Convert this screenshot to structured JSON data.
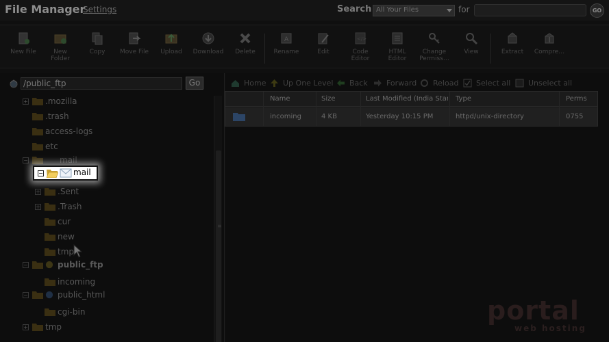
{
  "app": {
    "title": "File Manager",
    "settings_link": "Settings",
    "search_label": "Search",
    "search_scope": "All Your Files",
    "for_label": "for",
    "search_value": "",
    "go_label": "GO"
  },
  "toolbar": [
    {
      "label": "New File",
      "icon": "new-file-icon"
    },
    {
      "label": "New\nFolder",
      "icon": "new-folder-icon"
    },
    {
      "label": "Copy",
      "icon": "copy-icon"
    },
    {
      "label": "Move File",
      "icon": "move-file-icon"
    },
    {
      "label": "Upload",
      "icon": "upload-icon"
    },
    {
      "label": "Download",
      "icon": "download-icon"
    },
    {
      "label": "Delete",
      "icon": "delete-icon"
    },
    {
      "label": "Rename",
      "icon": "rename-icon"
    },
    {
      "label": "Edit",
      "icon": "edit-icon"
    },
    {
      "label": "Code\nEditor",
      "icon": "code-editor-icon"
    },
    {
      "label": "HTML\nEditor",
      "icon": "html-editor-icon"
    },
    {
      "label": "Change\nPermiss…",
      "icon": "change-permissions-icon"
    },
    {
      "label": "View",
      "icon": "view-icon"
    },
    {
      "label": "Extract",
      "icon": "extract-icon"
    },
    {
      "label": "Compre…",
      "icon": "compress-icon"
    }
  ],
  "path_bar": {
    "value": "/public_ftp",
    "go_label": "Go"
  },
  "tree": [
    {
      "label": ".mozilla",
      "expander": "+"
    },
    {
      "label": ".trash"
    },
    {
      "label": "access-logs"
    },
    {
      "label": "etc"
    },
    {
      "label": "mail",
      "expander": "-"
    },
    {
      "label": "mail",
      "expander": "-",
      "selected": true
    },
    {
      "label": ".Sent",
      "expander": "+"
    },
    {
      "label": ".Trash",
      "expander": "+"
    },
    {
      "label": "cur"
    },
    {
      "label": "new"
    },
    {
      "label": "tmp"
    },
    {
      "label": "public_ftp",
      "expander": "-",
      "bold": true
    },
    {
      "label": "incoming"
    },
    {
      "label": "public_html",
      "expander": "-"
    },
    {
      "label": "cgi-bin"
    },
    {
      "label": "tmp",
      "expander": "+"
    }
  ],
  "nav": {
    "home": "Home",
    "up": "Up One Level",
    "back": "Back",
    "forward": "Forward",
    "reload": "Reload",
    "select_all": "Select all",
    "unselect_all": "Unselect all"
  },
  "table": {
    "headers": [
      "Name",
      "Size",
      "Last Modified (India Standard Time)",
      "Type",
      "Perms"
    ],
    "rows": [
      {
        "name": "incoming",
        "size": "4 KB",
        "modified": "Yesterday 10:15 PM",
        "type": "httpd/unix-directory",
        "perms": "0755"
      }
    ]
  },
  "watermark": {
    "logo": "portal",
    "sub": "web hosting"
  },
  "colors": {
    "accent_red": "#5a2a2a",
    "folder": "#8a6a20",
    "selected_bg": "#ffffff"
  }
}
